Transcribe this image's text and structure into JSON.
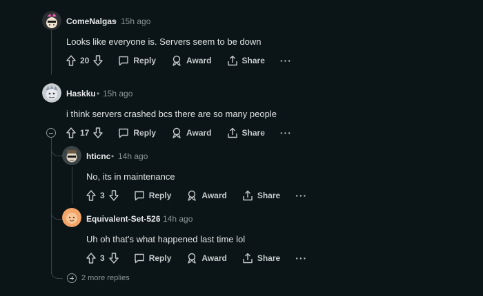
{
  "comments": [
    {
      "author": "ComeNalgas",
      "dot": "•",
      "time": "15h ago",
      "text": "Looks like everyone is. Servers seem to be down",
      "score": "20",
      "reply": "Reply",
      "award": "Award",
      "share": "Share",
      "more": "···"
    },
    {
      "author": "Haskku",
      "dot": "•",
      "time": "15h ago",
      "text": "i think servers crashed bcs there are so many people",
      "score": "17",
      "reply": "Reply",
      "award": "Award",
      "share": "Share",
      "more": "···"
    },
    {
      "author": "hticnc",
      "dot": "•",
      "time": "14h ago",
      "text": "No, its in maintenance",
      "score": "3",
      "reply": "Reply",
      "award": "Award",
      "share": "Share",
      "more": "···"
    },
    {
      "author": "Equivalent-Set-526",
      "dot": "•",
      "time": "14h ago",
      "text": "Uh oh that's what happened last time lol",
      "score": "3",
      "reply": "Reply",
      "award": "Award",
      "share": "Share",
      "more": "···"
    }
  ],
  "more_replies": "2 more replies",
  "colors": {
    "background": "#0b1416",
    "thread_line": "#3a4446",
    "avatar_equivalent": "#f3a56a"
  }
}
